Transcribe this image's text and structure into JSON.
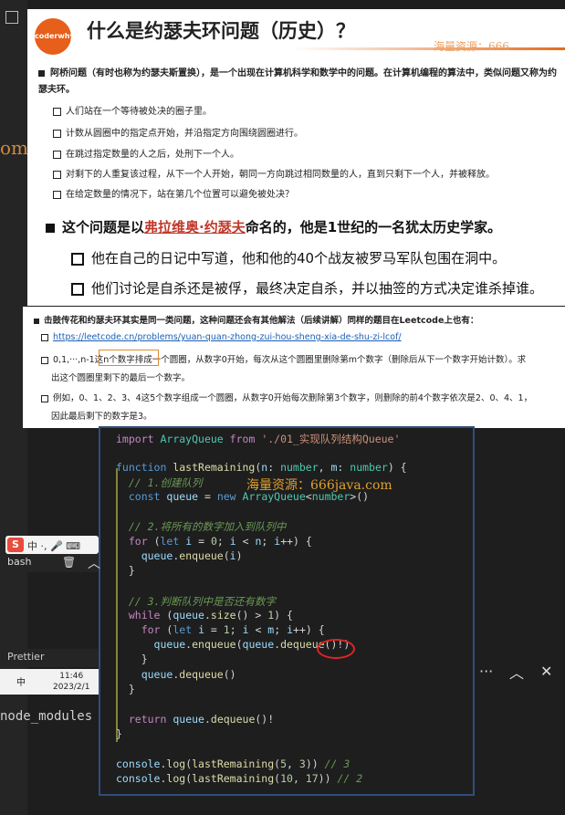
{
  "slide1": {
    "logo_text": "coderwhy",
    "title": "什么是约瑟夫环问题（历史）？",
    "watermark": "海量资源：666",
    "intro": "阿桥问题（有时也称为约瑟夫斯置换），是一个出现在计算机科学和数学中的问题。在计算机编程的算法中，类似问题又称为约瑟夫环。",
    "items": [
      "人们站在一个等待被处决的圈子里。",
      "计数从圆圈中的指定点开始，并沿指定方向围绕圆圈进行。",
      "在跳过指定数量的人之后，处刑下一个人。",
      "对剩下的人重复该过程，从下一个人开始，朝同一方向跳过相同数量的人，直到只剩下一个人，并被释放。",
      "在给定数量的情况下，站在第几个位置可以避免被处决？"
    ]
  },
  "slide2": {
    "head_pre": "这个问题是以",
    "head_name": "弗拉维奥·约瑟夫",
    "head_post": "命名的，他是1世纪的一名犹太历史学家。",
    "items": [
      "他在自己的日记中写道，他和他的40个战友被罗马军队包围在洞中。",
      "他们讨论是自杀还是被俘，最终决定自杀，并以抽签的方式决定谁杀掉谁。"
    ]
  },
  "slide3": {
    "head": "击鼓传花和约瑟夫环其实是同一类问题，这种问题还会有其他解法（后续讲解）同样的题目在Leetcode上也有：",
    "link": "https://leetcode.cn/problems/yuan-quan-zhong-zui-hou-sheng-xia-de-shu-zi-lcof/",
    "item2_line1": "0,1,···,n-1这n个数字排成一个圆圈，从数字0开始，每次从这个圆圈里删除第m个数字（删除后从下一个数字开始计数）。求",
    "item2_line2": "出这个圆圈里剩下的最后一个数字。",
    "item3_line1": "例如，0、1、2、3、4这5个数字组成一个圆圈，从数字0开始每次删除第3个数字，则删除的前4个数字依次是2、0、4、1，",
    "item3_line2": "因此最后剩下的数字是3。"
  },
  "code": {
    "watermark": "海量资源：666java.com"
  },
  "sidebar": {
    "fragment": "om",
    "ime_label": "中 ·, 🎤 ⌨",
    "terminal_label": "bash",
    "prettier_label": "Prettier",
    "clock_time": "11:46",
    "clock_date": "2023/2/1",
    "tray_lang": "中",
    "node_modules": "node_modules"
  },
  "toolbar": {
    "more": "···",
    "up": "︿",
    "close": "✕"
  }
}
